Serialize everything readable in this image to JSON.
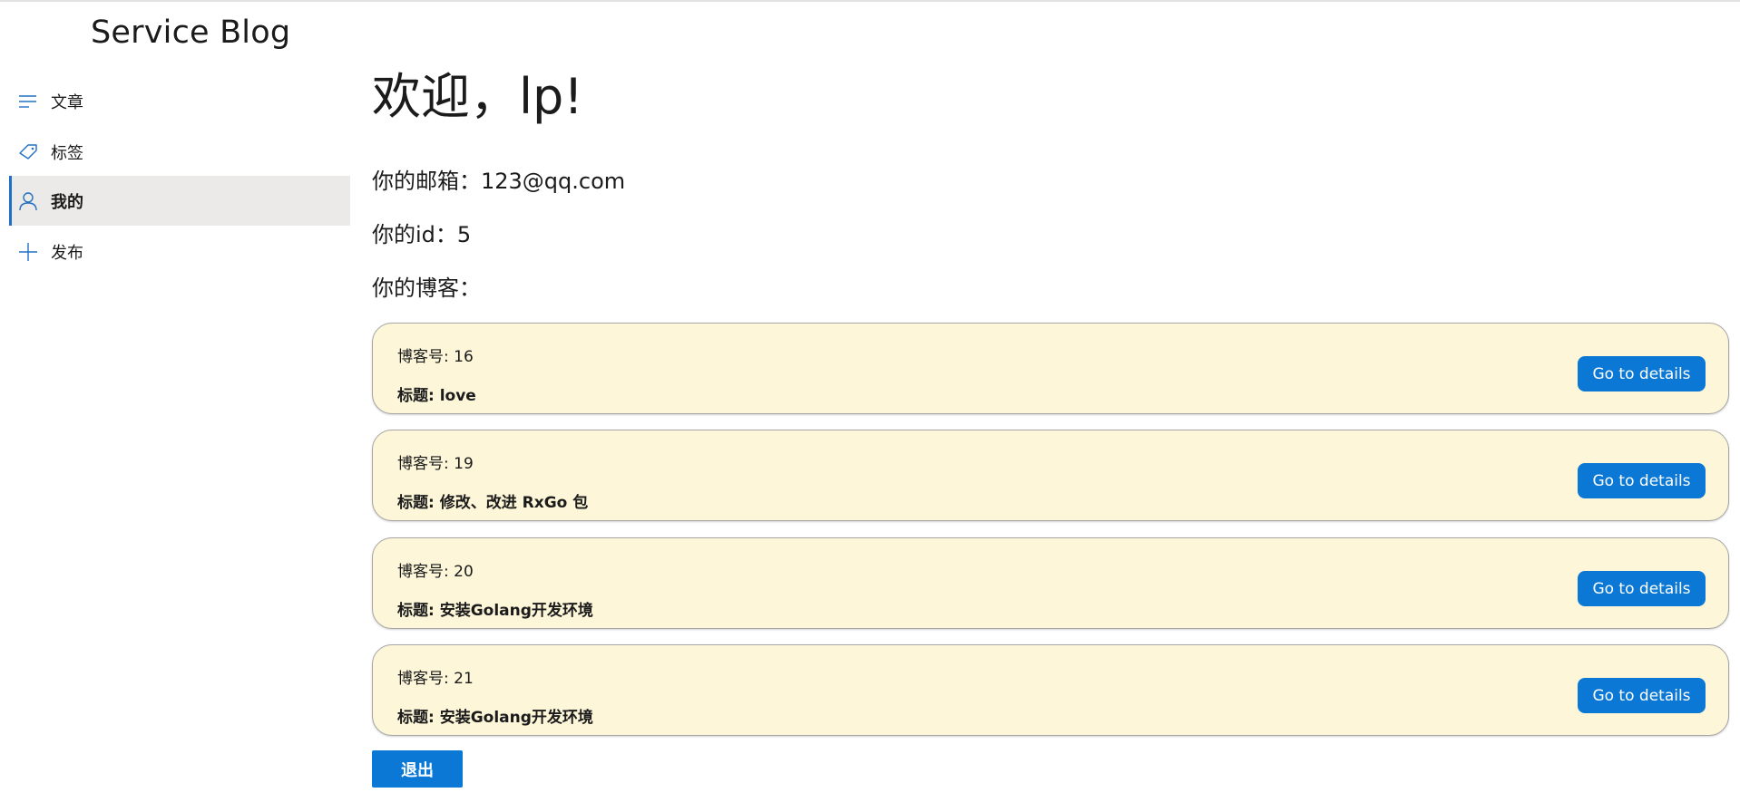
{
  "app": {
    "title": "Service Blog"
  },
  "sidebar": {
    "items": [
      {
        "label": "文章",
        "icon": "list-icon",
        "selected": false
      },
      {
        "label": "标签",
        "icon": "tag-icon",
        "selected": false
      },
      {
        "label": "我的",
        "icon": "person-icon",
        "selected": true
      },
      {
        "label": "发布",
        "icon": "plus-icon",
        "selected": false
      }
    ]
  },
  "profile": {
    "welcome": "欢迎，lp!",
    "email_line": "你的邮箱：123@qq.com",
    "id_line": "你的id：5",
    "blogs_heading": "你的博客："
  },
  "blogs": [
    {
      "number": "博客号: 16",
      "title": "标题: love",
      "button": "Go to details"
    },
    {
      "number": "博客号: 19",
      "title": "标题: 修改、改进 RxGo 包",
      "button": "Go to details"
    },
    {
      "number": "博客号: 20",
      "title": "标题: 安装Golang开发环境",
      "button": "Go to details"
    },
    {
      "number": "博客号: 21",
      "title": "标题: 安装Golang开发环境",
      "button": "Go to details"
    }
  ],
  "logout_label": "退出",
  "colors": {
    "accent": "#0a78d4",
    "card_bg": "#fdf6d9",
    "selected_bg": "#ebeae8",
    "icon_blue": "#2170c4"
  }
}
